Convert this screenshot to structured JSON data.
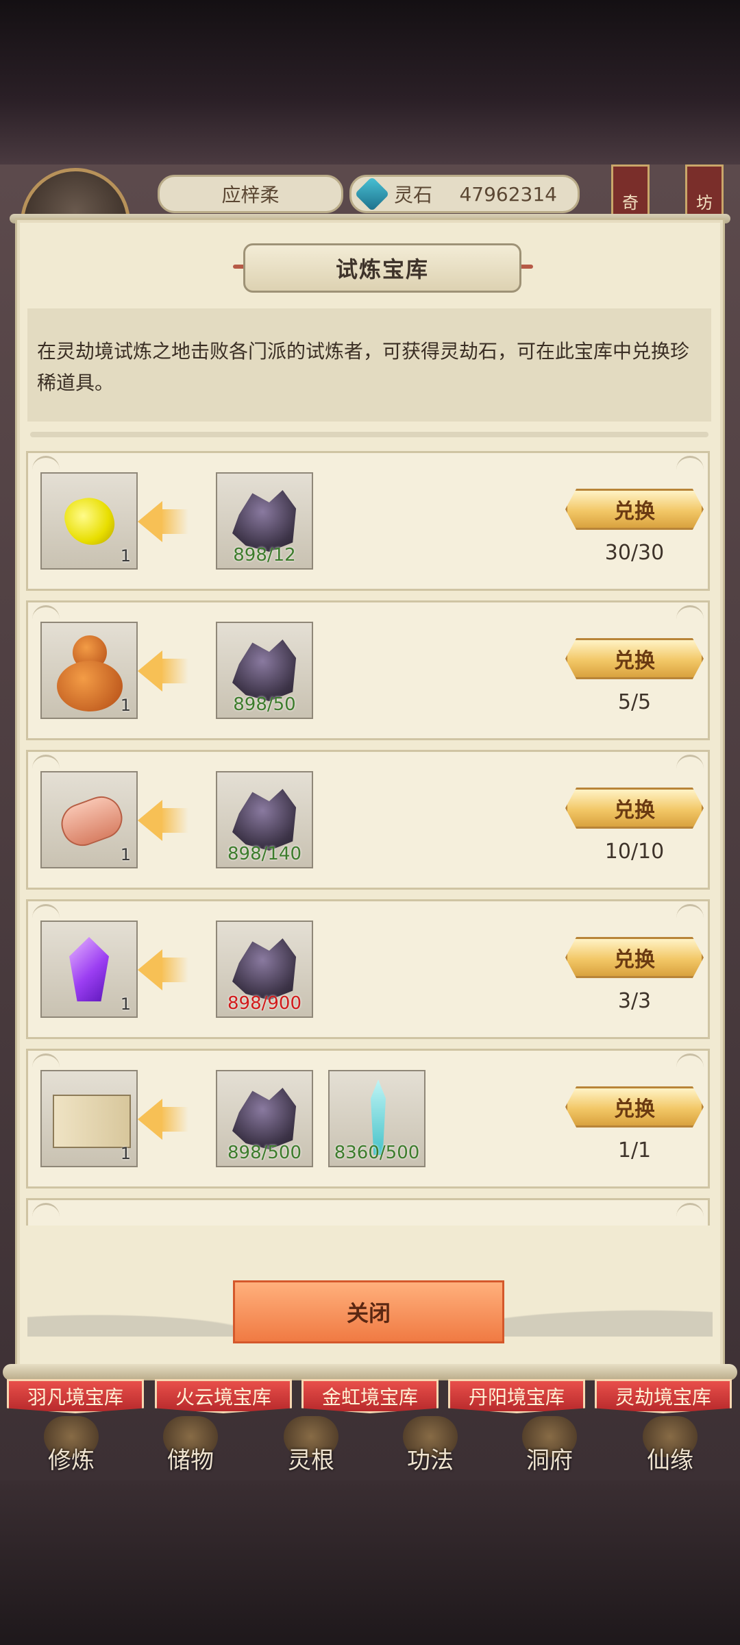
{
  "hud": {
    "player_name": "应梓柔",
    "currency_label": "灵石",
    "currency_value": "47962314",
    "side_tabs": [
      "奇",
      "坊"
    ]
  },
  "panel": {
    "title": "试炼宝库",
    "description": "在灵劫境试炼之地击败各门派的试炼者，可获得灵劫石，可在此宝库中兑换珍稀道具。"
  },
  "rows": [
    {
      "reward_icon": "yellow-stone-icon",
      "reward_qty": "1",
      "costs": [
        {
          "icon": "purple-rock-icon",
          "text": "898/12",
          "enough": true
        }
      ],
      "button": "兑换",
      "limit": "30/30"
    },
    {
      "reward_icon": "gourd-icon",
      "reward_qty": "1",
      "costs": [
        {
          "icon": "purple-rock-icon",
          "text": "898/50",
          "enough": true
        }
      ],
      "button": "兑换",
      "limit": "5/5"
    },
    {
      "reward_icon": "scroll-icon",
      "reward_qty": "1",
      "costs": [
        {
          "icon": "purple-rock-icon",
          "text": "898/140",
          "enough": true
        }
      ],
      "button": "兑换",
      "limit": "10/10"
    },
    {
      "reward_icon": "purple-crystal-icon",
      "reward_qty": "1",
      "costs": [
        {
          "icon": "purple-rock-icon",
          "text": "898/900",
          "enough": false
        }
      ],
      "button": "兑换",
      "limit": "3/3"
    },
    {
      "reward_icon": "book-icon",
      "reward_qty": "1",
      "costs": [
        {
          "icon": "purple-rock-icon",
          "text": "898/500",
          "enough": true
        },
        {
          "icon": "sword-icon",
          "text": "8360/500",
          "enough": true
        }
      ],
      "button": "兑换",
      "limit": "1/1"
    }
  ],
  "close_label": "关闭",
  "treasury_tabs": [
    "羽凡境宝库",
    "火云境宝库",
    "金虹境宝库",
    "丹阳境宝库",
    "灵劫境宝库"
  ],
  "nav": [
    "修炼",
    "储物",
    "灵根",
    "功法",
    "洞府",
    "仙缘"
  ],
  "colors": {
    "enough": "#3d7c2c",
    "not_enough": "#d11b1b",
    "tab_red": "#c8363a",
    "close_orange": "#f58a52"
  }
}
